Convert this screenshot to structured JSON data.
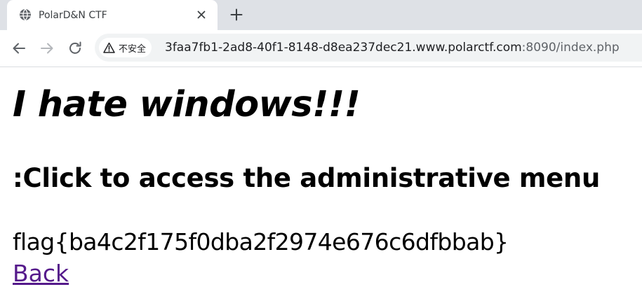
{
  "browser": {
    "tab": {
      "title": "PolarD&N CTF",
      "favicon": "globe-icon"
    },
    "address_bar": {
      "security_label": "不安全",
      "security_icon": "warning-triangle-icon",
      "url_host": "3faa7fb1-2ad8-40f1-8148-d8ea237dec21.www.polarctf.com",
      "url_rest": ":8090/index.php"
    },
    "nav_icons": [
      "back-arrow-icon",
      "forward-arrow-icon",
      "reload-icon"
    ]
  },
  "page": {
    "heading": "I hate windows!!!",
    "subheading": ":Click to access the administrative menu",
    "flag": "flag{ba4c2f175f0dba2f2974e676c6dfbbab}",
    "back_link": "Back"
  },
  "colors": {
    "tabstrip_bg": "#dee1e6",
    "omnibox_bg": "#f1f3f4",
    "visited_link": "#551a8b"
  }
}
